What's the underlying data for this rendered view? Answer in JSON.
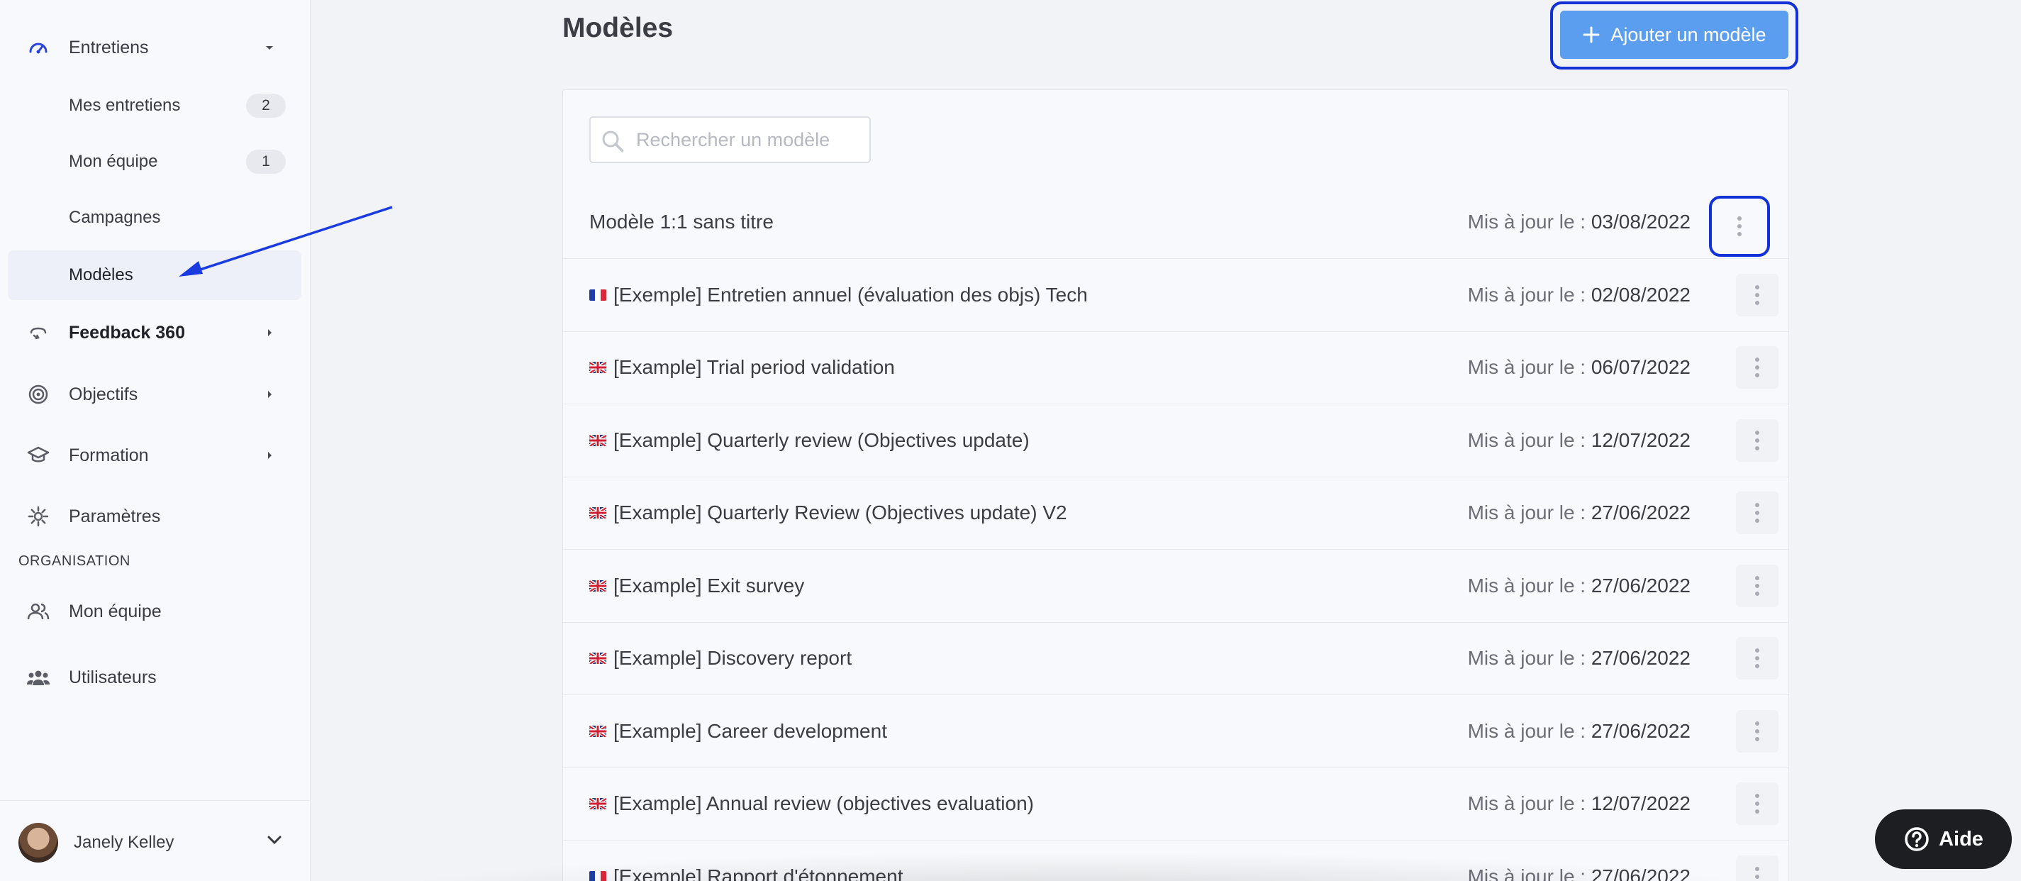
{
  "sidebar": {
    "items": [
      {
        "label": "Entretiens",
        "icon": "speedometer-icon"
      },
      {
        "label": "Feedback 360",
        "icon": "feedback-loop-icon"
      },
      {
        "label": "Objectifs",
        "icon": "target-icon"
      },
      {
        "label": "Formation",
        "icon": "graduation-cap-icon"
      },
      {
        "label": "Paramètres",
        "icon": "gear-icon"
      }
    ],
    "sub_items": [
      {
        "label": "Mes entretiens",
        "badge": "2"
      },
      {
        "label": "Mon équipe",
        "badge": "1"
      },
      {
        "label": "Campagnes"
      },
      {
        "label": "Modèles",
        "active": true
      }
    ],
    "org_section": {
      "title": "ORGANISATION",
      "items": [
        {
          "label": "Mon équipe",
          "icon": "team-icon"
        },
        {
          "label": "Utilisateurs",
          "icon": "users-icon"
        }
      ]
    },
    "user": {
      "name": "Janely Kelley"
    }
  },
  "main": {
    "title": "Modèles",
    "add_button": "Ajouter un modèle",
    "search_placeholder": "Rechercher un modèle",
    "updated_label": "Mis à jour le : ",
    "rows": [
      {
        "flag": "",
        "name": "Modèle 1:1 sans titre",
        "date": "03/08/2022"
      },
      {
        "flag": "fr",
        "name": "[Exemple] Entretien annuel (évaluation des objs) Tech",
        "date": "02/08/2022"
      },
      {
        "flag": "gb",
        "name": "[Example] Trial period validation",
        "date": "06/07/2022"
      },
      {
        "flag": "gb",
        "name": "[Example] Quarterly review (Objectives update)",
        "date": "12/07/2022"
      },
      {
        "flag": "gb",
        "name": "[Example] Quarterly Review (Objectives update) V2",
        "date": "27/06/2022"
      },
      {
        "flag": "gb",
        "name": "[Example] Exit survey",
        "date": "27/06/2022"
      },
      {
        "flag": "gb",
        "name": "[Example] Discovery report",
        "date": "27/06/2022"
      },
      {
        "flag": "gb",
        "name": "[Example] Career development",
        "date": "27/06/2022"
      },
      {
        "flag": "gb",
        "name": "[Example] Annual review (objectives evaluation)",
        "date": "12/07/2022"
      },
      {
        "flag": "fr",
        "name": "[Exemple] Rapport d'étonnement",
        "date": "27/06/2022"
      }
    ]
  },
  "help": {
    "label": "Aide"
  },
  "colors": {
    "accent": "#5b9ef0",
    "highlight": "#1232d8",
    "annotation_arrow": "#1a3be0"
  }
}
